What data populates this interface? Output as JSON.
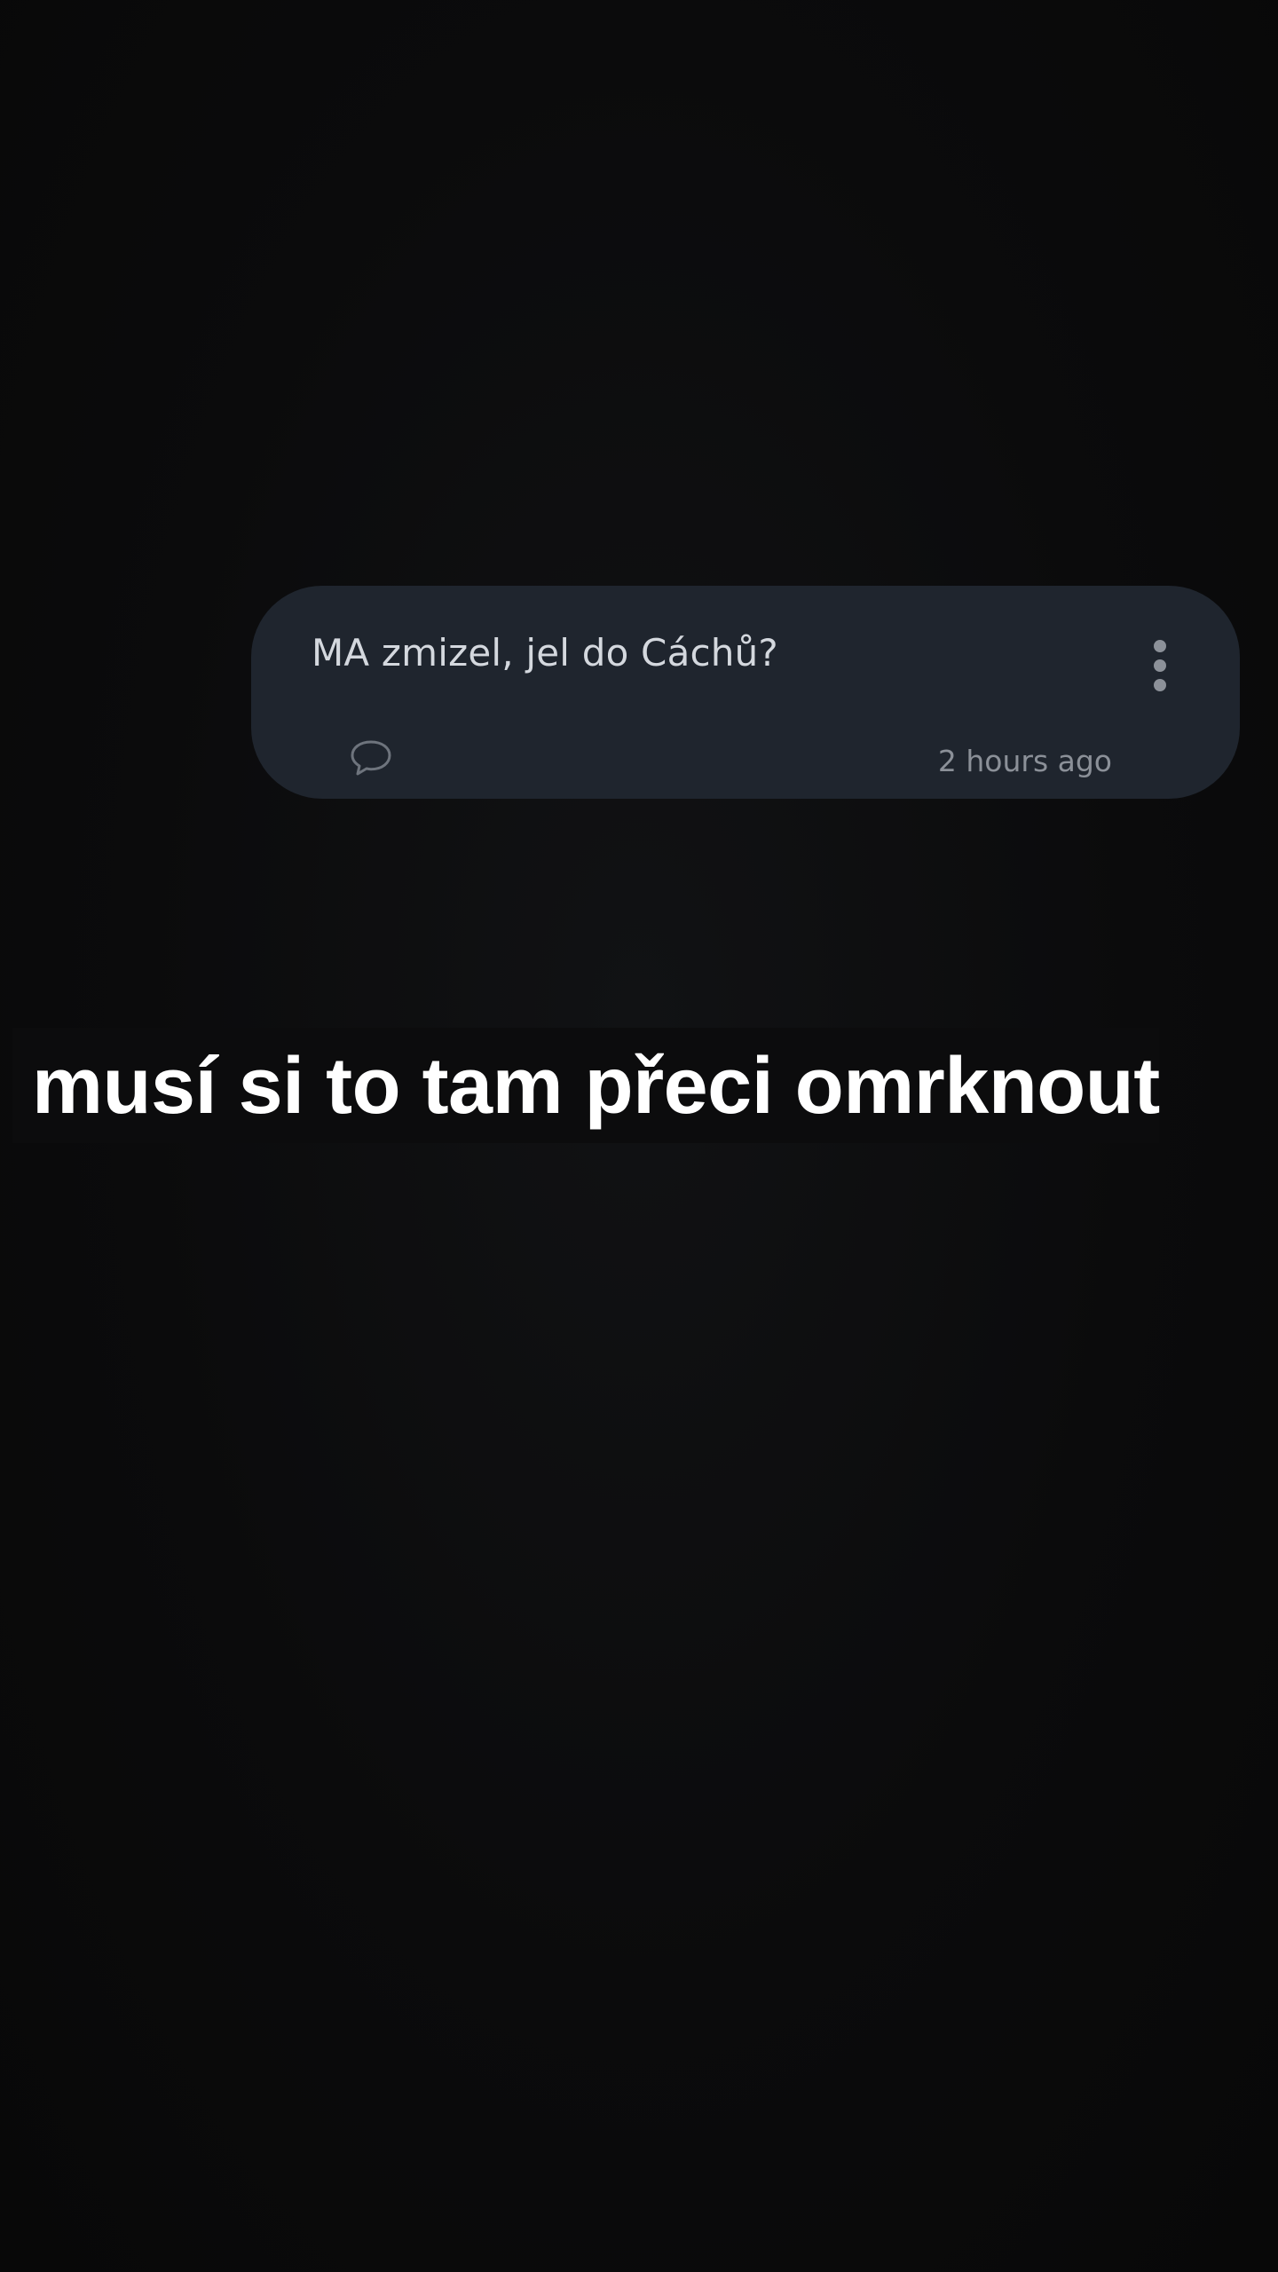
{
  "message": {
    "text": "MA zmizel, jel do Cáchů?",
    "timestamp": "2 hours ago",
    "more_icon": "more-vertical-icon",
    "comment_icon": "comment-bubble-icon"
  },
  "caption": {
    "text": "musí si to tam přeci omrknout"
  },
  "colors": {
    "background": "#0a0a0b",
    "card": "#1f252e",
    "message_text": "#d4d8de",
    "timestamp": "#8b9098",
    "caption_text": "#ffffff"
  }
}
